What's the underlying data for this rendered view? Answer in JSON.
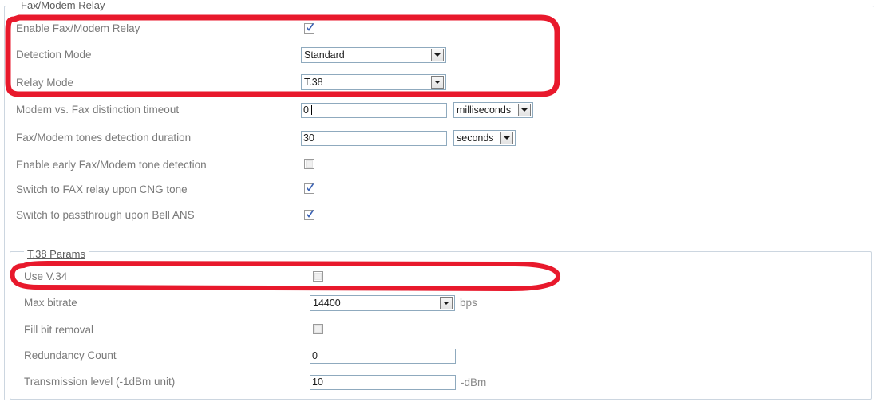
{
  "page": {
    "accent_red": "#e8192c",
    "label_color": "#7a7a7a",
    "border_color": "#ccd6e0"
  },
  "sections": {
    "fax_modem_relay": {
      "legend": "Fax/Modem Relay",
      "rows": [
        {
          "label": "Enable Fax/Modem Relay",
          "control": "checkbox",
          "checked": true
        },
        {
          "label": "Detection Mode",
          "control": "select",
          "value": "Standard"
        },
        {
          "label": "Relay Mode",
          "control": "select",
          "value": "T.38"
        },
        {
          "label": "Modem vs. Fax distinction timeout",
          "control": "text",
          "value": "0",
          "unit_select": "milliseconds"
        },
        {
          "label": "Fax/Modem tones detection duration",
          "control": "text",
          "value": "30",
          "unit_select": "seconds"
        },
        {
          "label": "Enable early Fax/Modem tone detection",
          "control": "checkbox",
          "checked": false
        },
        {
          "label": "Switch to FAX relay upon CNG tone",
          "control": "checkbox",
          "checked": true
        },
        {
          "label": "Switch to passthrough upon Bell ANS",
          "control": "checkbox",
          "checked": true
        }
      ]
    },
    "t38_params": {
      "legend": "T.38 Params",
      "rows": [
        {
          "label": "Use V.34",
          "control": "checkbox",
          "checked": false
        },
        {
          "label": "Max bitrate",
          "control": "select",
          "value": "14400",
          "unit": "bps"
        },
        {
          "label": "Fill bit removal",
          "control": "checkbox",
          "checked": false
        },
        {
          "label": "Redundancy Count",
          "control": "text",
          "value": "0"
        },
        {
          "label": "Transmission level (-1dBm unit)",
          "control": "text",
          "value": "10",
          "unit": "-dBm"
        }
      ]
    }
  },
  "annotations": [
    {
      "name": "highlight-relay-settings",
      "shape": "rounded-rectangle",
      "color": "#e8192c"
    },
    {
      "name": "highlight-use-v34",
      "shape": "oval",
      "color": "#e8192c"
    }
  ]
}
